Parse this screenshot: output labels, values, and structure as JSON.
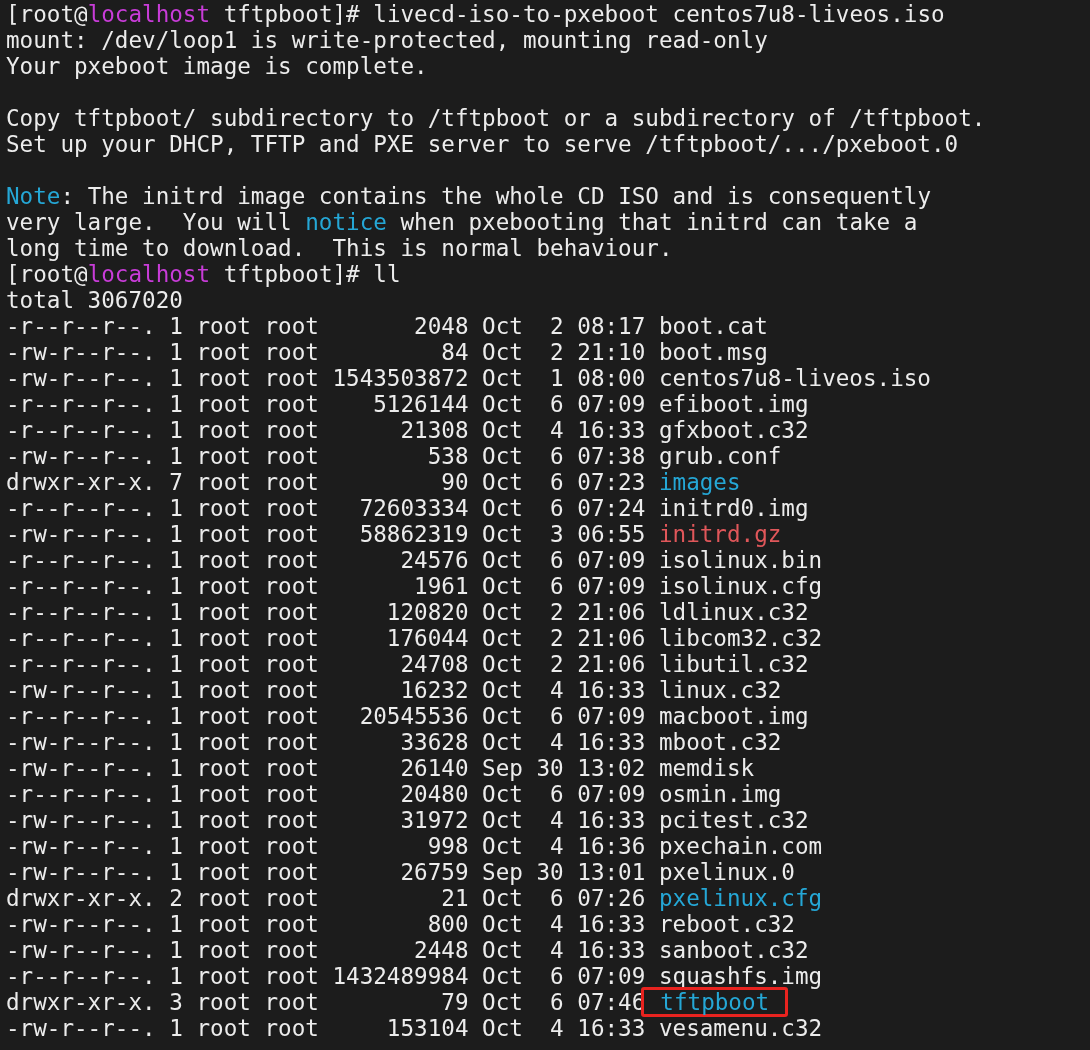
{
  "session": [
    {
      "segments": [
        {
          "text": "[root@",
          "kind": "plain"
        },
        {
          "text": "localhost",
          "kind": "host"
        },
        {
          "text": " tftpboot]# livecd-iso-to-pxeboot centos7u8-liveos.iso",
          "kind": "plain"
        }
      ]
    },
    {
      "segments": [
        {
          "text": "mount: /dev/loop1 is write-protected, mounting read-only",
          "kind": "plain"
        }
      ]
    },
    {
      "segments": [
        {
          "text": "Your pxeboot image is complete.",
          "kind": "plain"
        }
      ]
    },
    {
      "kind": "blank"
    },
    {
      "segments": [
        {
          "text": "Copy tftpboot/ subdirectory to /tftpboot or a subdirectory of /tftpboot.",
          "kind": "plain"
        }
      ]
    },
    {
      "segments": [
        {
          "text": "Set up your DHCP, TFTP and PXE server to serve /tftpboot/.../pxeboot.0",
          "kind": "plain"
        }
      ]
    },
    {
      "kind": "blank"
    },
    {
      "segments": [
        {
          "text": "Note",
          "kind": "keyword"
        },
        {
          "text": ": The initrd image contains the whole CD ISO and is consequently",
          "kind": "plain"
        }
      ]
    },
    {
      "segments": [
        {
          "text": "very large.  You will ",
          "kind": "plain"
        },
        {
          "text": "notice",
          "kind": "keyword"
        },
        {
          "text": " when pxebooting that initrd can take a",
          "kind": "plain"
        }
      ]
    },
    {
      "segments": [
        {
          "text": "long time to download.  This is normal behaviour.",
          "kind": "plain"
        }
      ]
    },
    {
      "segments": [
        {
          "text": "[root@",
          "kind": "plain"
        },
        {
          "text": "localhost",
          "kind": "host"
        },
        {
          "text": " tftpboot]# ll",
          "kind": "plain"
        }
      ]
    },
    {
      "segments": [
        {
          "text": "total 3067020",
          "kind": "plain"
        }
      ]
    }
  ],
  "listing": [
    {
      "details": "-r--r--r--. 1 root root       2048 Oct  2 08:17",
      "name": "boot.cat",
      "kind": "file",
      "highlighted": false
    },
    {
      "details": "-rw-r--r--. 1 root root         84 Oct  2 21:10",
      "name": "boot.msg",
      "kind": "file",
      "highlighted": false
    },
    {
      "details": "-rw-r--r--. 1 root root 1543503872 Oct  1 08:00",
      "name": "centos7u8-liveos.iso",
      "kind": "file",
      "highlighted": false
    },
    {
      "details": "-r--r--r--. 1 root root    5126144 Oct  6 07:09",
      "name": "efiboot.img",
      "kind": "file",
      "highlighted": false
    },
    {
      "details": "-r--r--r--. 1 root root      21308 Oct  4 16:33",
      "name": "gfxboot.c32",
      "kind": "file",
      "highlighted": false
    },
    {
      "details": "-rw-r--r--. 1 root root        538 Oct  6 07:38",
      "name": "grub.conf",
      "kind": "file",
      "highlighted": false
    },
    {
      "details": "drwxr-xr-x. 7 root root         90 Oct  6 07:23",
      "name": "images",
      "kind": "dir",
      "highlighted": false
    },
    {
      "details": "-r--r--r--. 1 root root   72603334 Oct  6 07:24",
      "name": "initrd0.img",
      "kind": "file",
      "highlighted": false
    },
    {
      "details": "-rw-r--r--. 1 root root   58862319 Oct  3 06:55",
      "name": "initrd.gz",
      "kind": "archive",
      "highlighted": false
    },
    {
      "details": "-r--r--r--. 1 root root      24576 Oct  6 07:09",
      "name": "isolinux.bin",
      "kind": "file",
      "highlighted": false
    },
    {
      "details": "-r--r--r--. 1 root root       1961 Oct  6 07:09",
      "name": "isolinux.cfg",
      "kind": "file",
      "highlighted": false
    },
    {
      "details": "-r--r--r--. 1 root root     120820 Oct  2 21:06",
      "name": "ldlinux.c32",
      "kind": "file",
      "highlighted": false
    },
    {
      "details": "-r--r--r--. 1 root root     176044 Oct  2 21:06",
      "name": "libcom32.c32",
      "kind": "file",
      "highlighted": false
    },
    {
      "details": "-r--r--r--. 1 root root      24708 Oct  2 21:06",
      "name": "libutil.c32",
      "kind": "file",
      "highlighted": false
    },
    {
      "details": "-rw-r--r--. 1 root root      16232 Oct  4 16:33",
      "name": "linux.c32",
      "kind": "file",
      "highlighted": false
    },
    {
      "details": "-r--r--r--. 1 root root   20545536 Oct  6 07:09",
      "name": "macboot.img",
      "kind": "file",
      "highlighted": false
    },
    {
      "details": "-rw-r--r--. 1 root root      33628 Oct  4 16:33",
      "name": "mboot.c32",
      "kind": "file",
      "highlighted": false
    },
    {
      "details": "-rw-r--r--. 1 root root      26140 Sep 30 13:02",
      "name": "memdisk",
      "kind": "file",
      "highlighted": false
    },
    {
      "details": "-r--r--r--. 1 root root      20480 Oct  6 07:09",
      "name": "osmin.img",
      "kind": "file",
      "highlighted": false
    },
    {
      "details": "-rw-r--r--. 1 root root      31972 Oct  4 16:33",
      "name": "pcitest.c32",
      "kind": "file",
      "highlighted": false
    },
    {
      "details": "-rw-r--r--. 1 root root        998 Oct  4 16:36",
      "name": "pxechain.com",
      "kind": "file",
      "highlighted": false
    },
    {
      "details": "-rw-r--r--. 1 root root      26759 Sep 30 13:01",
      "name": "pxelinux.0",
      "kind": "file",
      "highlighted": false
    },
    {
      "details": "drwxr-xr-x. 2 root root         21 Oct  6 07:26",
      "name": "pxelinux.cfg",
      "kind": "dir",
      "highlighted": false
    },
    {
      "details": "-rw-r--r--. 1 root root        800 Oct  4 16:33",
      "name": "reboot.c32",
      "kind": "file",
      "highlighted": false
    },
    {
      "details": "-rw-r--r--. 1 root root       2448 Oct  4 16:33",
      "name": "sanboot.c32",
      "kind": "file",
      "highlighted": false
    },
    {
      "details": "-r--r--r--. 1 root root 1432489984 Oct  6 07:09",
      "name": "squashfs.img",
      "kind": "file",
      "highlighted": false
    },
    {
      "details": "drwxr-xr-x. 3 root root         79 Oct  6 07:46",
      "name": "tftpboot",
      "kind": "dir",
      "highlighted": true
    },
    {
      "details": "-rw-r--r--. 1 root root     153104 Oct  4 16:33",
      "name": "vesamenu.c32",
      "kind": "file",
      "highlighted": false
    }
  ]
}
